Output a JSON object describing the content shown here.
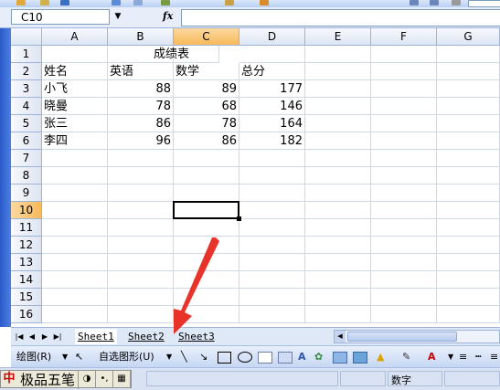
{
  "formula_bar": {
    "name_box": "C10",
    "fx_label": "fx",
    "formula_value": ""
  },
  "columns": [
    "A",
    "B",
    "C",
    "D",
    "E",
    "F",
    "G"
  ],
  "selected_column": "C",
  "rows": [
    "1",
    "2",
    "3",
    "4",
    "5",
    "6",
    "7",
    "8",
    "9",
    "10",
    "11",
    "12",
    "13",
    "14",
    "15",
    "16"
  ],
  "selected_row": "10",
  "sheet": {
    "title": "成绩表",
    "headers": [
      "姓名",
      "英语",
      "数学",
      "总分"
    ],
    "records": [
      {
        "name": "小飞",
        "english": "88",
        "math": "89",
        "total": "177"
      },
      {
        "name": "晓曼",
        "english": "78",
        "math": "68",
        "total": "146"
      },
      {
        "name": "张三",
        "english": "86",
        "math": "78",
        "total": "164"
      },
      {
        "name": "李四",
        "english": "96",
        "math": "86",
        "total": "182"
      }
    ]
  },
  "sheet_tabs": [
    "Sheet1",
    "Sheet2",
    "Sheet3"
  ],
  "drawing_toolbar": {
    "draw_label": "绘图(R)",
    "autoshapes_label": "自选图形(U)"
  },
  "status_bar": {
    "mode": "数字",
    "ime_name": "极品五笔",
    "ime_logo": "中"
  },
  "colors": {
    "selected_header": "#f8b95a",
    "grid_line": "#d0d7e5",
    "arrow": "#e8332a"
  }
}
